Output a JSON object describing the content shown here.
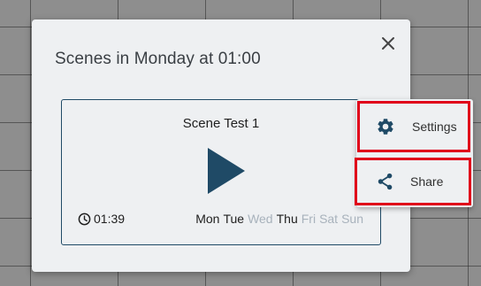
{
  "dialog": {
    "title": "Scenes in Monday at 01:00",
    "close_icon": "close-icon"
  },
  "scene": {
    "name": "Scene Test 1",
    "play_icon": "play-icon",
    "duration_icon": "clock-icon",
    "duration": "01:39",
    "days": [
      {
        "label": "Mon",
        "active": true
      },
      {
        "label": "Tue",
        "active": true
      },
      {
        "label": "Wed",
        "active": false
      },
      {
        "label": "Thu",
        "active": true
      },
      {
        "label": "Fri",
        "active": false
      },
      {
        "label": "Sat",
        "active": false
      },
      {
        "label": "Sun",
        "active": false
      }
    ]
  },
  "menu": {
    "items": [
      {
        "label": "Settings",
        "icon": "gear-icon"
      },
      {
        "label": "Share",
        "icon": "share-icon"
      }
    ]
  },
  "colors": {
    "accent": "#1f4a66",
    "highlight_border": "#e0001a",
    "inactive_day": "#a8b2bc"
  }
}
